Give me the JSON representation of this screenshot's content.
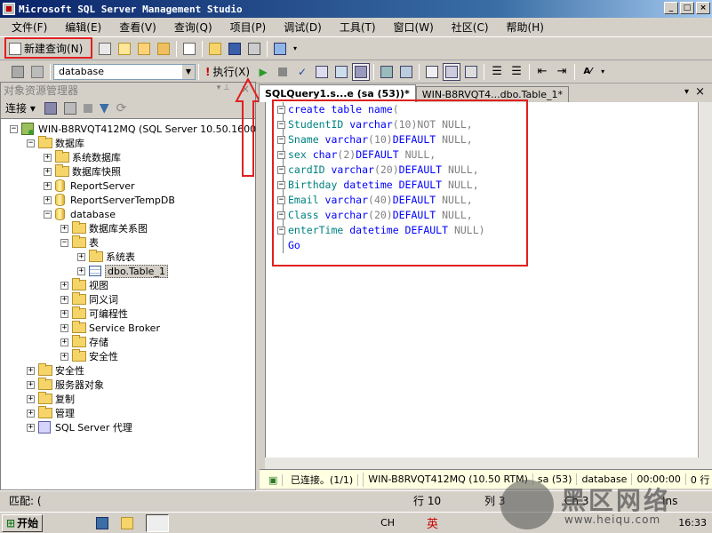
{
  "window": {
    "title": "Microsoft SQL Server Management Studio",
    "buttons": [
      "_",
      "□",
      "×"
    ]
  },
  "menu": [
    "文件(F)",
    "编辑(E)",
    "查看(V)",
    "查询(Q)",
    "项目(P)",
    "调试(D)",
    "工具(T)",
    "窗口(W)",
    "社区(C)",
    "帮助(H)"
  ],
  "toolbar": {
    "new_query": "新建查询(N)",
    "database": "database",
    "execute": "执行(X)"
  },
  "object_explorer": {
    "title": "对象资源管理器",
    "connect": "连接",
    "tree": [
      {
        "label": "WIN-B8RVQT412MQ (SQL Server 10.50.1600",
        "level": 0,
        "icon": "server-icon",
        "toggle": "−"
      },
      {
        "label": "数据库",
        "level": 1,
        "icon": "folder-icon",
        "toggle": "−"
      },
      {
        "label": "系统数据库",
        "level": 2,
        "icon": "folder-icon",
        "toggle": "+"
      },
      {
        "label": "数据库快照",
        "level": 2,
        "icon": "folder-icon",
        "toggle": "+"
      },
      {
        "label": "ReportServer",
        "level": 2,
        "icon": "database-icon",
        "toggle": "+"
      },
      {
        "label": "ReportServerTempDB",
        "level": 2,
        "icon": "database-icon",
        "toggle": "+"
      },
      {
        "label": "database",
        "level": 2,
        "icon": "database-icon",
        "toggle": "−"
      },
      {
        "label": "数据库关系图",
        "level": 3,
        "icon": "folder-icon",
        "toggle": "+"
      },
      {
        "label": "表",
        "level": 3,
        "icon": "folder-icon",
        "toggle": "−"
      },
      {
        "label": "系统表",
        "level": 4,
        "icon": "folder-icon",
        "toggle": "+"
      },
      {
        "label": "dbo.Table_1",
        "level": 4,
        "icon": "table-icon",
        "toggle": "+",
        "selected": true
      },
      {
        "label": "视图",
        "level": 3,
        "icon": "folder-icon",
        "toggle": "+"
      },
      {
        "label": "同义词",
        "level": 3,
        "icon": "folder-icon",
        "toggle": "+"
      },
      {
        "label": "可编程性",
        "level": 3,
        "icon": "folder-icon",
        "toggle": "+"
      },
      {
        "label": "Service Broker",
        "level": 3,
        "icon": "folder-icon",
        "toggle": "+"
      },
      {
        "label": "存储",
        "level": 3,
        "icon": "folder-icon",
        "toggle": "+"
      },
      {
        "label": "安全性",
        "level": 3,
        "icon": "folder-icon",
        "toggle": "+"
      },
      {
        "label": "安全性",
        "level": 1,
        "icon": "folder-icon",
        "toggle": "+"
      },
      {
        "label": "服务器对象",
        "level": 1,
        "icon": "folder-icon",
        "toggle": "+"
      },
      {
        "label": "复制",
        "level": 1,
        "icon": "folder-icon",
        "toggle": "+"
      },
      {
        "label": "管理",
        "level": 1,
        "icon": "folder-icon",
        "toggle": "+"
      },
      {
        "label": "SQL Server 代理",
        "level": 1,
        "icon": "agent-icon",
        "toggle": "+"
      }
    ]
  },
  "tabs": [
    {
      "label": "SQLQuery1.s...e (sa (53))*",
      "active": true
    },
    {
      "label": "WIN-B8RVQT4...dbo.Table_1*",
      "active": false
    }
  ],
  "code": [
    [
      "kw:create table name",
      "gr:("
    ],
    [
      "fn:StudentID varchar",
      "gr:(10)",
      "gr:NOT NULL,"
    ],
    [
      "fn:Sname varchar",
      "gr:(10)",
      "kw:DEFAULT",
      "gr: NULL,"
    ],
    [
      "fn:sex char",
      "gr:(2)",
      "kw:DEFAULT",
      "gr: NULL,"
    ],
    [
      "fn:cardID varchar",
      "gr:(20)",
      "kw:DEFAULT",
      "gr: NULL,"
    ],
    [
      "fn:Birthday datetime DEFAULT",
      "gr: NULL,"
    ],
    [
      "fn:Email varchar",
      "gr:(40)",
      "kw:DEFAULT",
      "gr: NULL,"
    ],
    [
      "fn:Class varchar",
      "gr:(20)",
      "kw:DEFAULT",
      "gr: NULL,"
    ],
    [
      "fn:enterTime datetime DEFAULT",
      "gr: NULL)"
    ],
    [
      "kw:Go"
    ]
  ],
  "query_status": {
    "connected": "已连接。(1/1)",
    "server": "WIN-B8RVQT412MQ (10.50 RTM)",
    "user": "sa (53)",
    "db": "database",
    "time": "00:00:00",
    "rows": "0 行"
  },
  "status": {
    "ready": "匹配: (",
    "line": "行 10",
    "col": "列 3",
    "ch": "Ch 3",
    "ins": "Ins"
  },
  "taskbar": {
    "start": "开始",
    "ime": "CH",
    "lang": "英",
    "clock": "16:33"
  },
  "watermark": {
    "title": "黑区网络",
    "url": "www.heiqu.com"
  }
}
